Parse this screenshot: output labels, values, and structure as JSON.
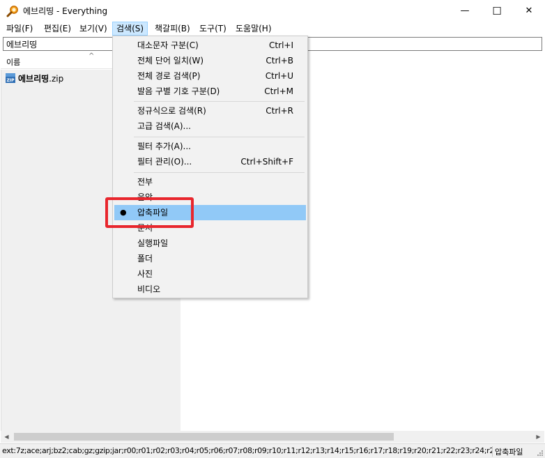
{
  "window": {
    "title": "에브리띵 - Everything",
    "minimize_glyph": "—",
    "maximize_glyph": "☐",
    "close_glyph": "✕"
  },
  "menubar": [
    {
      "label": "파일(F)"
    },
    {
      "label": "편집(E)"
    },
    {
      "label": "보기(V)"
    },
    {
      "label": "검색(S)"
    },
    {
      "label": "책갈피(B)"
    },
    {
      "label": "도구(T)"
    },
    {
      "label": "도움말(H)"
    }
  ],
  "search": {
    "value": "에브리띵"
  },
  "columns": {
    "name_header": "이름",
    "sort_glyph": "^"
  },
  "results": [
    {
      "name_bold": "에브리띵",
      "ext": ".zip",
      "icon": "zip-icon"
    }
  ],
  "search_menu": {
    "group1": [
      {
        "label": "대소문자 구분(C)",
        "shortcut": "Ctrl+I"
      },
      {
        "label": "전체 단어 일치(W)",
        "shortcut": "Ctrl+B"
      },
      {
        "label": "전체 경로 검색(P)",
        "shortcut": "Ctrl+U"
      },
      {
        "label": "발음 구별 기호 구분(D)",
        "shortcut": "Ctrl+M"
      }
    ],
    "group2": [
      {
        "label": "정규식으로 검색(R)",
        "shortcut": "Ctrl+R"
      },
      {
        "label": "고급 검색(A)...",
        "shortcut": ""
      }
    ],
    "group3": [
      {
        "label": "필터 추가(A)...",
        "shortcut": ""
      },
      {
        "label": "필터 관리(O)...",
        "shortcut": "Ctrl+Shift+F"
      }
    ],
    "filters": [
      {
        "label": "전부"
      },
      {
        "label": "음악"
      },
      {
        "label": "압축파일"
      },
      {
        "label": "문서"
      },
      {
        "label": "실행파일"
      },
      {
        "label": "폴더"
      },
      {
        "label": "사진"
      },
      {
        "label": "비디오"
      }
    ],
    "selected_filter": "압축파일",
    "bullet": "●"
  },
  "statusbar": {
    "filter_text": "ext:7z;ace;arj;bz2;cab;gz;gzip;jar;r00;r01;r02;r03;r04;r05;r06;r07;r08;r09;r10;r11;r12;r13;r14;r15;r16;r17;r18;r19;r20;r21;r22;r23;r24;r25;r2",
    "active_filter": "압축파일"
  },
  "colors": {
    "highlight": "#91c9f7",
    "menu_active": "#cce8ff",
    "annotation": "#e8262d"
  }
}
